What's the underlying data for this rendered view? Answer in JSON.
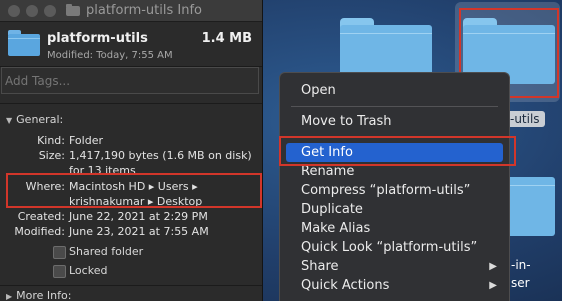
{
  "window": {
    "title": "platform-utils Info",
    "name": "platform-utils",
    "size": "1.4 MB",
    "modified": "Modified: Today, 7:55 AM",
    "tags_placeholder": "Add Tags..."
  },
  "general": {
    "header": "General:",
    "kind_label": "Kind:",
    "kind_value": "Folder",
    "size_label": "Size:",
    "size_value": "1,417,190 bytes (1.6 MB on disk)",
    "size_value_2": "for 13 items",
    "where_label": "Where:",
    "where_value": "Macintosh HD ▸ Users ▸",
    "where_value_2": "krishnakumar ▸ Desktop",
    "created_label": "Created:",
    "created_value": "June 22, 2021 at 2:29 PM",
    "modified_label": "Modified:",
    "modified_value": "June 23, 2021 at 7:55 AM",
    "shared_folder": "Shared folder",
    "locked": "Locked"
  },
  "more_info": {
    "header": "More Info:"
  },
  "desktop": {
    "selected_label": "-utils",
    "other_label_1": "-in-",
    "other_label_2": "ser"
  },
  "context_menu": {
    "items": [
      "Open",
      "Move to Trash",
      "Get Info",
      "Rename",
      "Compress “platform-utils”",
      "Duplicate",
      "Make Alias",
      "Quick Look “platform-utils”",
      "Share",
      "Quick Actions"
    ],
    "highlighted": "Get Info"
  },
  "colors": {
    "highlight": "#2462cf",
    "annotation": "#d2362a",
    "folder": "#6fb6e6"
  }
}
